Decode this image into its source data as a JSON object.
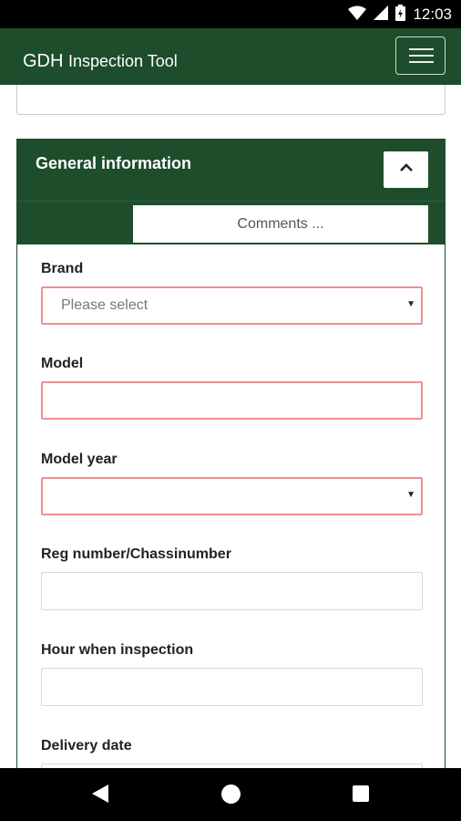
{
  "status_bar": {
    "time": "12:03",
    "icons": [
      "wifi-icon",
      "cellular-signal-icon",
      "battery-icon"
    ]
  },
  "app_bar": {
    "title_brand": "GDH",
    "title_rest": "Inspection Tool",
    "menu_icon": "hamburger-menu-icon"
  },
  "panel": {
    "title": "General information",
    "collapse_icon": "chevron-up-icon",
    "comments_label": "Comments ..."
  },
  "form": {
    "brand": {
      "label": "Brand",
      "placeholder": "Please select",
      "value": ""
    },
    "model": {
      "label": "Model",
      "value": ""
    },
    "model_year": {
      "label": "Model year",
      "value": ""
    },
    "reg_number": {
      "label": "Reg number/Chassinumber",
      "value": ""
    },
    "hour_inspection": {
      "label": "Hour when inspection",
      "value": ""
    },
    "delivery_date": {
      "label": "Delivery date",
      "value": ""
    }
  },
  "nav_bar": {
    "icons": [
      "back-icon",
      "home-icon",
      "recent-apps-icon"
    ]
  },
  "colors": {
    "primary_green": "#1e4d2b",
    "error_border": "#f08f8f"
  }
}
